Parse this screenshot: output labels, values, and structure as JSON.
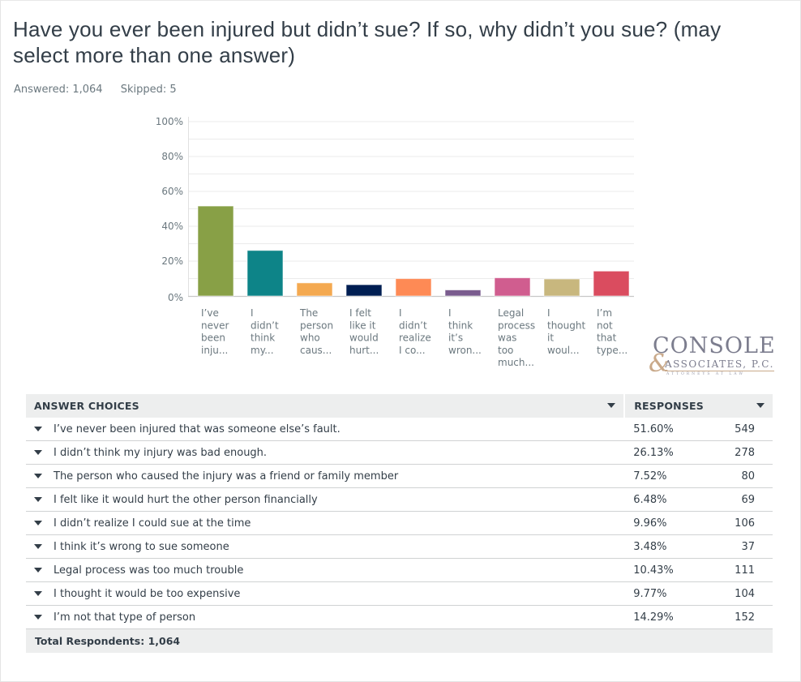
{
  "question": {
    "title": "Have you ever been injured but didn’t sue? If so, why didn’t you sue? (may select more than one answer)",
    "answered_label": "Answered: 1,064",
    "skipped_label": "Skipped: 5"
  },
  "chart_data": {
    "type": "bar",
    "title": "",
    "xlabel": "",
    "ylabel": "",
    "ylim": [
      0,
      100
    ],
    "yticks": [
      "0%",
      "20%",
      "40%",
      "60%",
      "80%",
      "100%"
    ],
    "ytick_values": [
      0,
      20,
      40,
      60,
      80,
      100
    ],
    "grid": true,
    "categories": [
      [
        "I’ve",
        "never",
        "been",
        "inju..."
      ],
      [
        "I",
        "didn’t",
        "think",
        "my..."
      ],
      [
        "The",
        "person",
        "who",
        "caus..."
      ],
      [
        "I felt",
        "like it",
        "would",
        "hurt..."
      ],
      [
        "I",
        "didn’t",
        "realize",
        "I co..."
      ],
      [
        "I",
        "think",
        "it’s",
        "wron..."
      ],
      [
        "Legal",
        "process",
        "was",
        "too",
        "much..."
      ],
      [
        "I",
        "thought",
        "it",
        "woul..."
      ],
      [
        "I’m",
        "not",
        "that",
        "type..."
      ]
    ],
    "values": [
      51.6,
      26.13,
      7.52,
      6.48,
      9.96,
      3.48,
      10.43,
      9.77,
      14.29
    ],
    "colors": [
      "#88a046",
      "#0d8488",
      "#f4a950",
      "#001e52",
      "#fe8a55",
      "#7a5c8e",
      "#d05d8f",
      "#c8b77e",
      "#da4c5f"
    ]
  },
  "logo": {
    "line1": "CONSOLE",
    "ampersand": "&",
    "line2": "ASSOCIATES, P.C.",
    "line3": "ATTORNEYS AT LAW"
  },
  "table": {
    "header_answer": "ANSWER CHOICES",
    "header_responses": "RESPONSES",
    "rows": [
      {
        "answer": "I’ve never been injured that was someone else’s fault.",
        "percent": "51.60%",
        "count": "549"
      },
      {
        "answer": "I didn’t think my injury was bad enough.",
        "percent": "26.13%",
        "count": "278"
      },
      {
        "answer": "The person who caused the injury was a friend or family member",
        "percent": "7.52%",
        "count": "80"
      },
      {
        "answer": "I felt like it would hurt the other person financially",
        "percent": "6.48%",
        "count": "69"
      },
      {
        "answer": "I didn’t realize I could sue at the time",
        "percent": "9.96%",
        "count": "106"
      },
      {
        "answer": "I think it’s wrong to sue someone",
        "percent": "3.48%",
        "count": "37"
      },
      {
        "answer": "Legal process was too much trouble",
        "percent": "10.43%",
        "count": "111"
      },
      {
        "answer": "I thought it would be too expensive",
        "percent": "9.77%",
        "count": "104"
      },
      {
        "answer": "I’m not that type of person",
        "percent": "14.29%",
        "count": "152"
      }
    ],
    "total_label": "Total Respondents: 1,064"
  }
}
